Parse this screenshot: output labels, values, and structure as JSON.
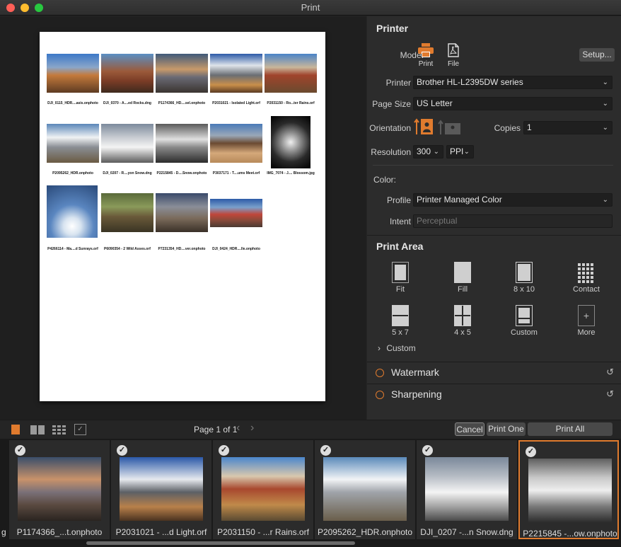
{
  "window": {
    "title": "Print"
  },
  "paper_thumbs": [
    {
      "caption": "DJI_0115_HDR....asis.onphoto",
      "grad": "linear-gradient(#3c78c8 0%,#8aa6c9 35%,#c47a3c 55%,#5e3b22 100%)"
    },
    {
      "caption": "DJI_0370 - A....ed Rocks.dng",
      "grad": "linear-gradient(#5a8fc4 0%,#9b5a3a 45%,#7a3c26 70%,#3e2a1e 100%)"
    },
    {
      "caption": "P1174366_HD....sel.onphoto",
      "grad": "linear-gradient(#405a7a 0%,#c89a6a 40%,#6a6a74 60%,#3a3430 100%)"
    },
    {
      "caption": "P2031021 - Isolated Light.orf",
      "grad": "linear-gradient(#2c5aa8 0%,#dfe4ea 30%,#6a6e74 55%,#c98f4a 80%,#5a3a22 100%)"
    },
    {
      "caption": "P2031150 - Ro...ter Rains.orf",
      "grad": "linear-gradient(#4a84c8 0%,#c9b69a 35%,#a0442c 55%,#6a4a2e 100%)"
    },
    {
      "caption": "P2095262_HDR.onphoto",
      "grad": "linear-gradient(#5a86b8 0%,#f0f2f4 35%,#8a8e94 60%,#6a5a42 100%)"
    },
    {
      "caption": "DJI_0207 - R....yon Snow.dng",
      "grad": "linear-gradient(#7c8a9c 0%,#c8ccd2 35%,#f4f4f4 60%,#5a5a5a 100%)"
    },
    {
      "caption": "P2215845 - D....Snow.onphoto",
      "grad": "linear-gradient(#5a5a5a 0%,#e0e0e0 40%,#8a8a8a 60%,#2c2c2c 100%)"
    },
    {
      "caption": "P3037171 - T....ums Meet.orf",
      "grad": "linear-gradient(#4a7ab8 0%,#9aa8b8 30%,#6a4a32 50%,#d4a87a 75%,#b88a5a 100%)"
    },
    {
      "caption": "IMG_7074 - J.... Blossom.jpg",
      "grad": "radial-gradient(circle at 50% 50%,#f0f0f0 0%,#8a8a8a 30%,#2a2a2a 60%,#000 100%)"
    },
    {
      "caption": "P4266114 - Ma....d Sunrays.orf",
      "grad": "radial-gradient(circle at 50% 78%,#ffffff 0%,#d8e4f0 18%,#5a86c0 45%,#2a4a7a 100%)"
    },
    {
      "caption": "P6090354 - 2 Wild Asses.orf",
      "grad": "linear-gradient(#5a6a3a 0%,#8a9a5a 35%,#6a5a3a 60%,#3a3424 100%)"
    },
    {
      "caption": "P7231354_HD....ver.onphoto",
      "grad": "linear-gradient(#3a4a6a 0%,#8a8e98 35%,#7a6a5a 65%,#3a3028 100%)"
    },
    {
      "caption": "DJI_0424_HDR....lle.onphoto",
      "grad": "linear-gradient(#2c5aa8 0%,#7aa0cc 30%,#c0463a 55%,#8a4a3a 75%,#4a3a32 100%)"
    }
  ],
  "panel": {
    "printer_title": "Printer",
    "mode_label": "Mode:",
    "mode_print": "Print",
    "mode_file": "File",
    "setup_label": "Setup...",
    "printer_label": "Printer",
    "printer_value": "Brother HL-L2395DW series",
    "page_size_label": "Page Size",
    "page_size_value": "US Letter",
    "orientation_label": "Orientation",
    "copies_label": "Copies",
    "copies_value": "1",
    "resolution_label": "Resolution",
    "resolution_value": "300",
    "resolution_unit": "PPI",
    "color_label": "Color:",
    "profile_label": "Profile",
    "profile_value": "Printer Managed Color",
    "intent_label": "Intent",
    "intent_value": "Perceptual",
    "print_area_title": "Print Area",
    "print_area_items": [
      "Fit",
      "Fill",
      "8 x 10",
      "Contact",
      "5 x 7",
      "4 x 5",
      "Custom",
      "More"
    ],
    "custom_expander": "Custom",
    "watermark_label": "Watermark",
    "sharpening_label": "Sharpening"
  },
  "toolbar": {
    "page_indicator": "Page 1 of 1",
    "cancel_label": "Cancel",
    "print_one_label": "Print One",
    "print_all_label": "Print All"
  },
  "filmstrip": [
    {
      "name": "P1174366_...t.onphoto",
      "grad": "linear-gradient(#3a4e6a 0%,#c8926a 35%,#7a7078 55%,#5a4a40 75%,#2a2420 100%)"
    },
    {
      "name": "P2031021 - ...d Light.orf",
      "grad": "linear-gradient(#2a58a8 0%,#e6e9ee 35%,#5c6066 55%,#b8804a 78%,#4a3220 100%)"
    },
    {
      "name": "P2031150 - ...r Rains.orf",
      "grad": "linear-gradient(#4a86cc 0%,#d8c8ae 30%,#a8482e 50%,#c08a4a 75%,#5a4a32 100%)"
    },
    {
      "name": "P2095262_HDR.onphoto",
      "grad": "linear-gradient(#5a8aba 0%,#f2f4f6 35%,#a0a4aa 55%,#6a5e4a 100%)"
    },
    {
      "name": "DJI_0207 -...n Snow.dng",
      "grad": "linear-gradient(#7a889a 0%,#b6bcc4 30%,#f4f4f4 55%,#9a9a9a 80%,#4a4a4a 100%)"
    },
    {
      "name": "P2215845 -...ow.onphoto",
      "grad": "linear-gradient(#5e5e5e 0%,#c8c8c8 30%,#eeeeee 50%,#7a7a7a 75%,#2c2c2c 100%)"
    }
  ],
  "colors": {
    "accent": "#e07b2e"
  }
}
